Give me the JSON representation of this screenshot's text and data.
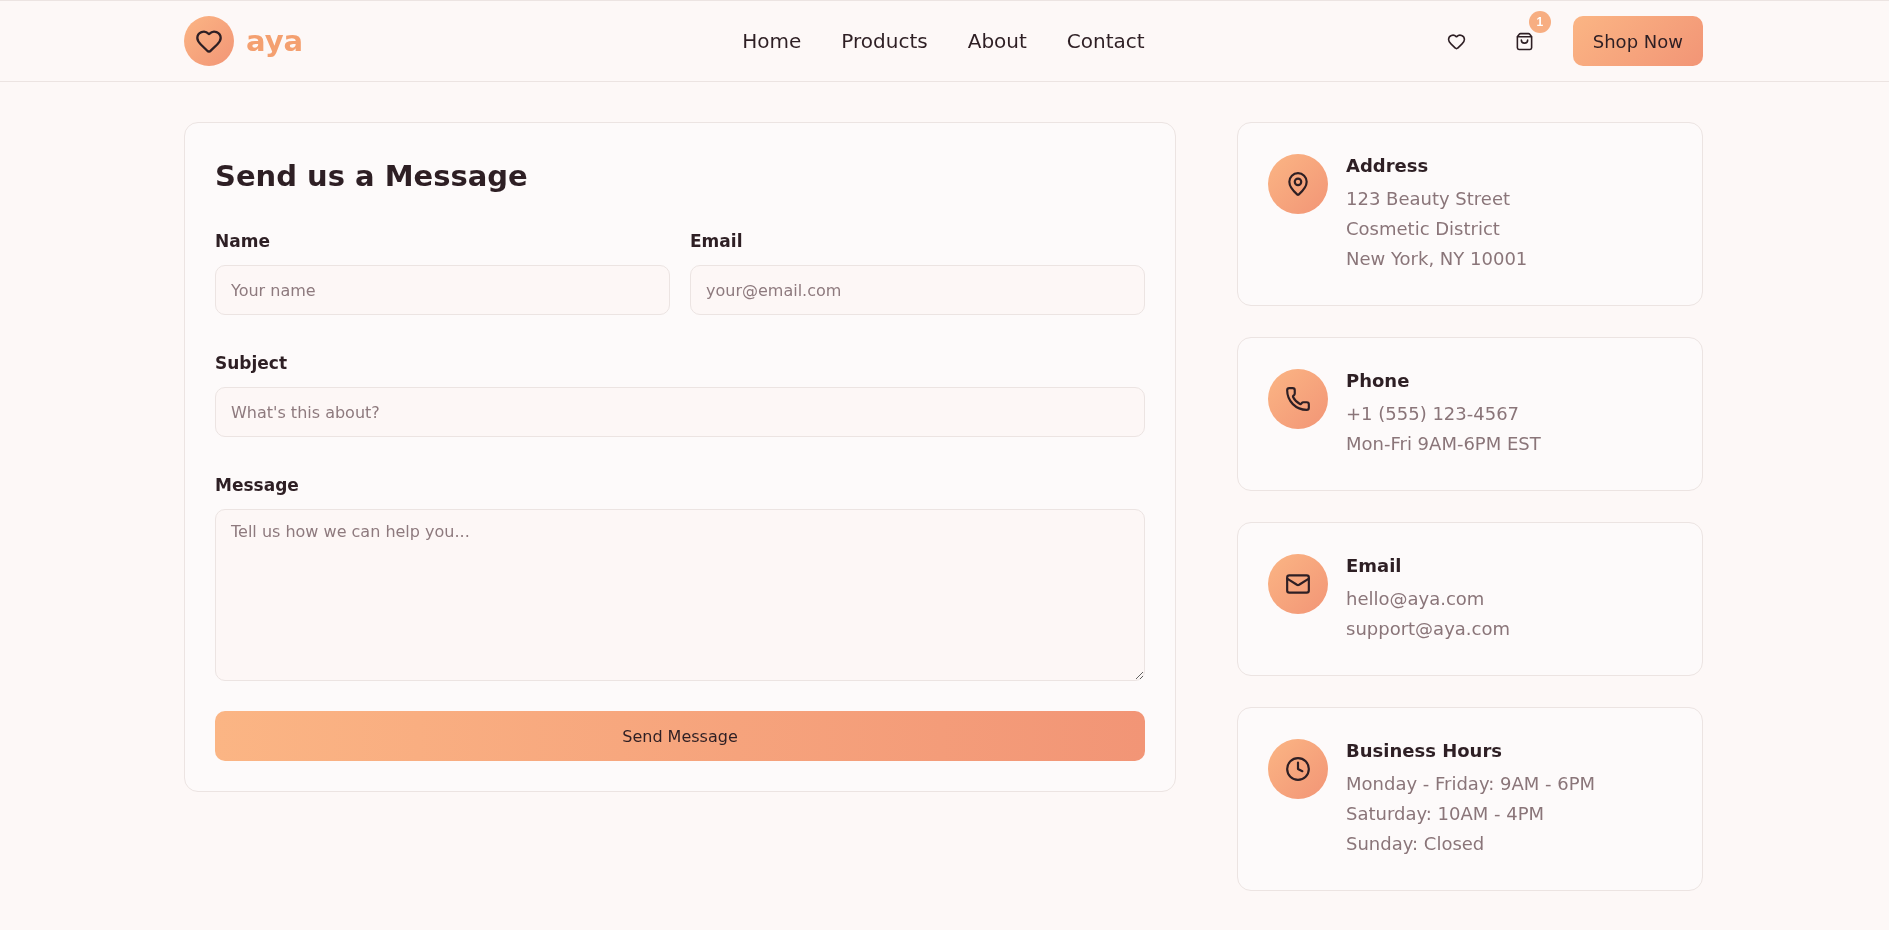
{
  "header": {
    "logo": "aya",
    "nav": [
      "Home",
      "Products",
      "About",
      "Contact"
    ],
    "cart_badge": "1",
    "cta": "Shop Now"
  },
  "form": {
    "title": "Send us a Message",
    "rows": [
      [
        {
          "kind": "input",
          "label": "Name",
          "placeholder": "Your name"
        },
        {
          "kind": "input",
          "label": "Email",
          "placeholder": "your@email.com"
        }
      ],
      [
        {
          "kind": "input",
          "label": "Subject",
          "placeholder": "What's this about?"
        }
      ],
      [
        {
          "kind": "textarea",
          "label": "Message",
          "placeholder": "Tell us how we can help you..."
        }
      ]
    ],
    "submit": "Send Message"
  },
  "contact_cards": [
    {
      "kind": "pin",
      "title": "Address",
      "lines": [
        "123 Beauty Street",
        "Cosmetic District",
        "New York, NY 10001"
      ]
    },
    {
      "kind": "phone",
      "title": "Phone",
      "lines": [
        "+1 (555) 123-4567",
        "Mon-Fri 9AM-6PM EST"
      ]
    },
    {
      "kind": "mail",
      "title": "Email",
      "lines": [
        "hello@aya.com",
        "support@aya.com"
      ]
    },
    {
      "kind": "clock",
      "title": "Business Hours",
      "lines": [
        "Monday - Friday: 9AM - 6PM",
        "Saturday: 10AM - 4PM",
        "Sunday: Closed"
      ]
    }
  ]
}
